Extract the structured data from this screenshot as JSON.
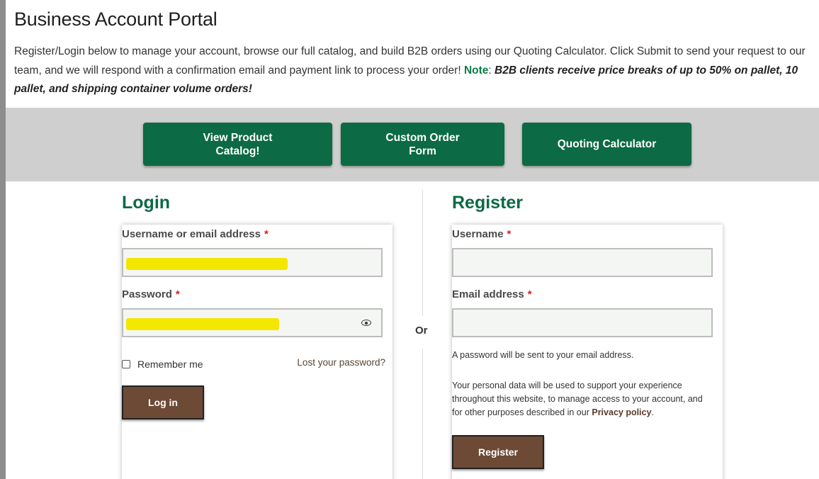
{
  "header": {
    "title": "Business Account Portal",
    "intro_text": "Register/Login below to manage your account, browse our full catalog, and build B2B orders using our Quoting Calculator. Click Submit to send your request to our team, and we will respond with a confirmation email and payment link to process your order!",
    "note_label": "Note",
    "note_text": "B2B clients receive price breaks of up to 50% on pallet, 10 pallet, and shipping container volume orders!"
  },
  "toolbar": {
    "view_catalog_line1": "View Product",
    "view_catalog_line2": "Catalog!",
    "custom_order_line1": "Custom Order",
    "custom_order_line2": "Form",
    "quoting_calculator": "Quoting Calculator"
  },
  "login": {
    "title": "Login",
    "username_label": "Username or email address",
    "password_label": "Password",
    "required_marker": "*",
    "remember_me": "Remember me",
    "lost_password": "Lost your password?",
    "login_button": "Log in"
  },
  "divider": {
    "or": "Or"
  },
  "register": {
    "title": "Register",
    "username_label": "Username",
    "email_label": "Email address",
    "required_marker": "*",
    "password_notice": "A password will be sent to your email address.",
    "privacy_line1": "Your personal data will be used to support your experience",
    "privacy_line2": "throughout this website, to manage access to your account, and",
    "privacy_line3_prefix": "for other purposes described in our",
    "privacy_link": "Privacy policy",
    "privacy_line3_suffix": ".",
    "register_button": "Register"
  },
  "colors": {
    "brand_green": "#0c6a44",
    "button_brown": "#6d4a36",
    "redaction_yellow": "#f3e700",
    "required_red": "#d42020"
  }
}
